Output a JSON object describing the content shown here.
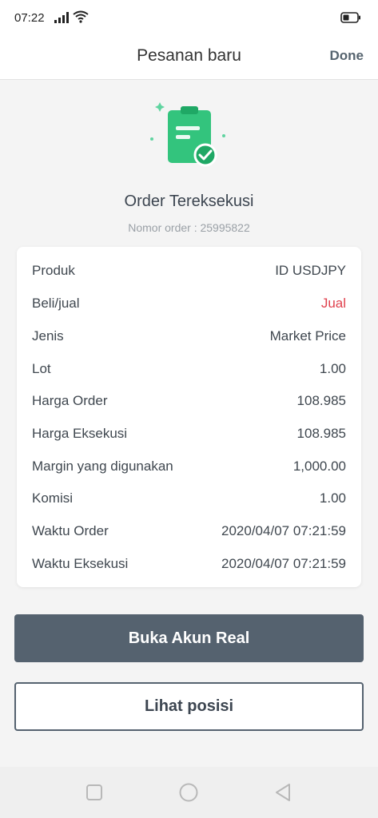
{
  "status_bar": {
    "time": "07:22"
  },
  "header": {
    "title": "Pesanan baru",
    "done_label": "Done"
  },
  "order": {
    "title": "Order Tereksekusi",
    "number_text": "Nomor order : 25995822"
  },
  "details": [
    {
      "label": "Produk",
      "value": "ID USDJPY"
    },
    {
      "label": "Beli/jual",
      "value": "Jual"
    },
    {
      "label": "Jenis",
      "value": "Market Price"
    },
    {
      "label": "Lot",
      "value": "1.00"
    },
    {
      "label": "Harga Order",
      "value": "108.985"
    },
    {
      "label": "Harga Eksekusi",
      "value": "108.985"
    },
    {
      "label": "Margin yang digunakan",
      "value": "1,000.00"
    },
    {
      "label": "Komisi",
      "value": "1.00"
    },
    {
      "label": "Waktu Order",
      "value": "2020/04/07 07:21:59"
    },
    {
      "label": "Waktu Eksekusi",
      "value": "2020/04/07 07:21:59"
    }
  ],
  "actions": {
    "primary_label": "Buka Akun Real",
    "secondary_label": "Lihat posisi"
  },
  "colors": {
    "accent_green": "#2ecc71",
    "sell_red": "#e0414d",
    "button_dark": "#55626f"
  }
}
